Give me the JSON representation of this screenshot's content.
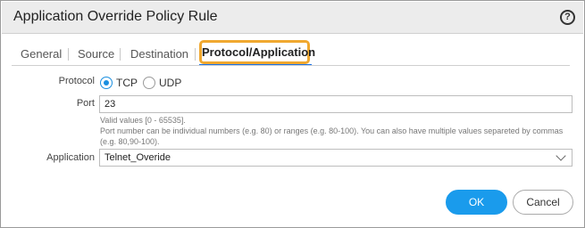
{
  "dialog": {
    "title": "Application Override Policy Rule",
    "help_icon": "?"
  },
  "tabs": [
    {
      "label": "General"
    },
    {
      "label": "Source"
    },
    {
      "label": "Destination"
    },
    {
      "label": "Protocol/Application",
      "active": true
    }
  ],
  "form": {
    "protocol_label": "Protocol",
    "protocol_options": [
      {
        "label": "TCP",
        "selected": true
      },
      {
        "label": "UDP",
        "selected": false
      }
    ],
    "port_label": "Port",
    "port_value": "23",
    "port_hint_1": "Valid values [0 - 65535].",
    "port_hint_2": "Port number can be individual numbers (e.g. 80) or ranges (e.g. 80-100). You can also have multiple values separeted by commas",
    "port_hint_3": "(e.g. 80,90-100).",
    "application_label": "Application",
    "application_value": "Telnet_Overide"
  },
  "buttons": {
    "ok": "OK",
    "cancel": "Cancel"
  },
  "colors": {
    "accent": "#1a9bec",
    "tab_highlight": "#f0a830"
  }
}
